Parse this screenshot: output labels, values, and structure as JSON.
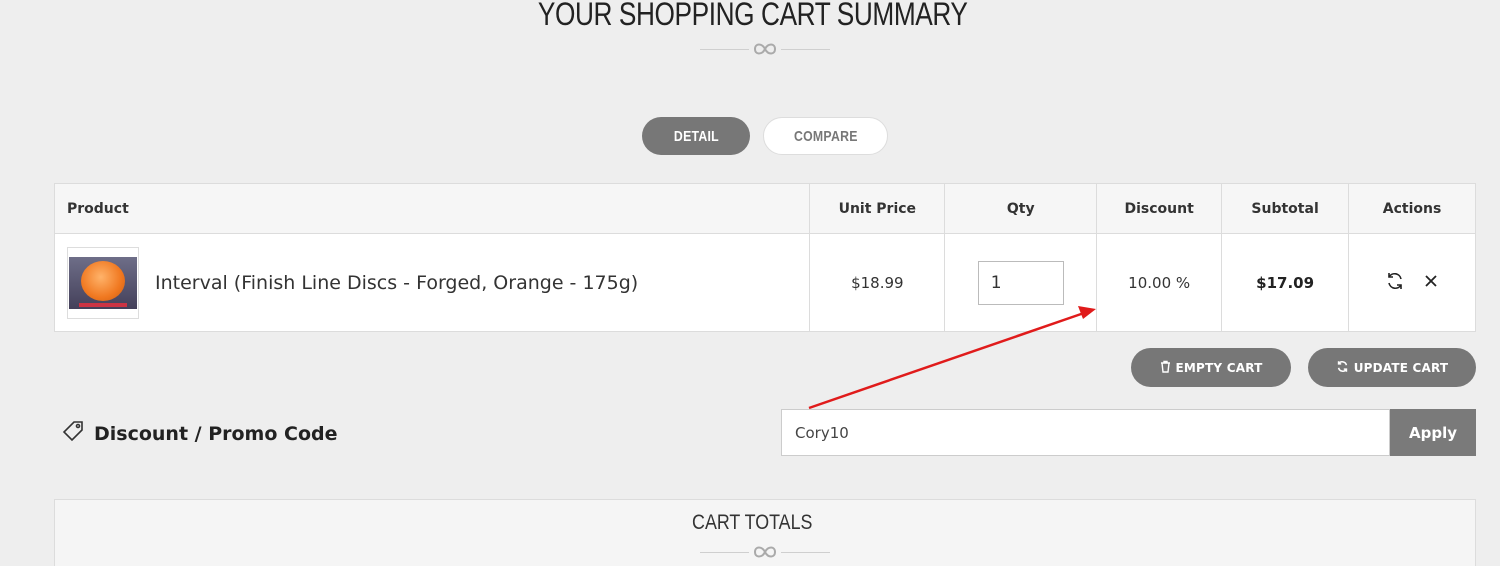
{
  "header": {
    "title": "YOUR SHOPPING CART SUMMARY"
  },
  "view_toggle": {
    "detail_label": "DETAIL",
    "compare_label": "COMPARE"
  },
  "table": {
    "columns": [
      "Product",
      "Unit Price",
      "Qty",
      "Discount",
      "Subtotal",
      "Actions"
    ],
    "rows": [
      {
        "product": "Interval (Finish Line Discs - Forged, Orange - 175g)",
        "unit_price": "$18.99",
        "qty": "1",
        "discount": "10.00 %",
        "subtotal": "$17.09"
      }
    ]
  },
  "cart_actions": {
    "empty_label": "EMPTY CART",
    "update_label": "UPDATE CART"
  },
  "promo": {
    "label": "Discount / Promo Code",
    "value": "Cory10",
    "apply_label": "Apply"
  },
  "totals": {
    "title": "CART TOTALS"
  },
  "icons": [
    "infinity-icon",
    "refresh-icon",
    "close-icon",
    "trash-icon",
    "tag-icon"
  ],
  "colors": {
    "button_gray": "#777777",
    "annotation_arrow": "#e01b1b",
    "background": "#eeeeee"
  }
}
